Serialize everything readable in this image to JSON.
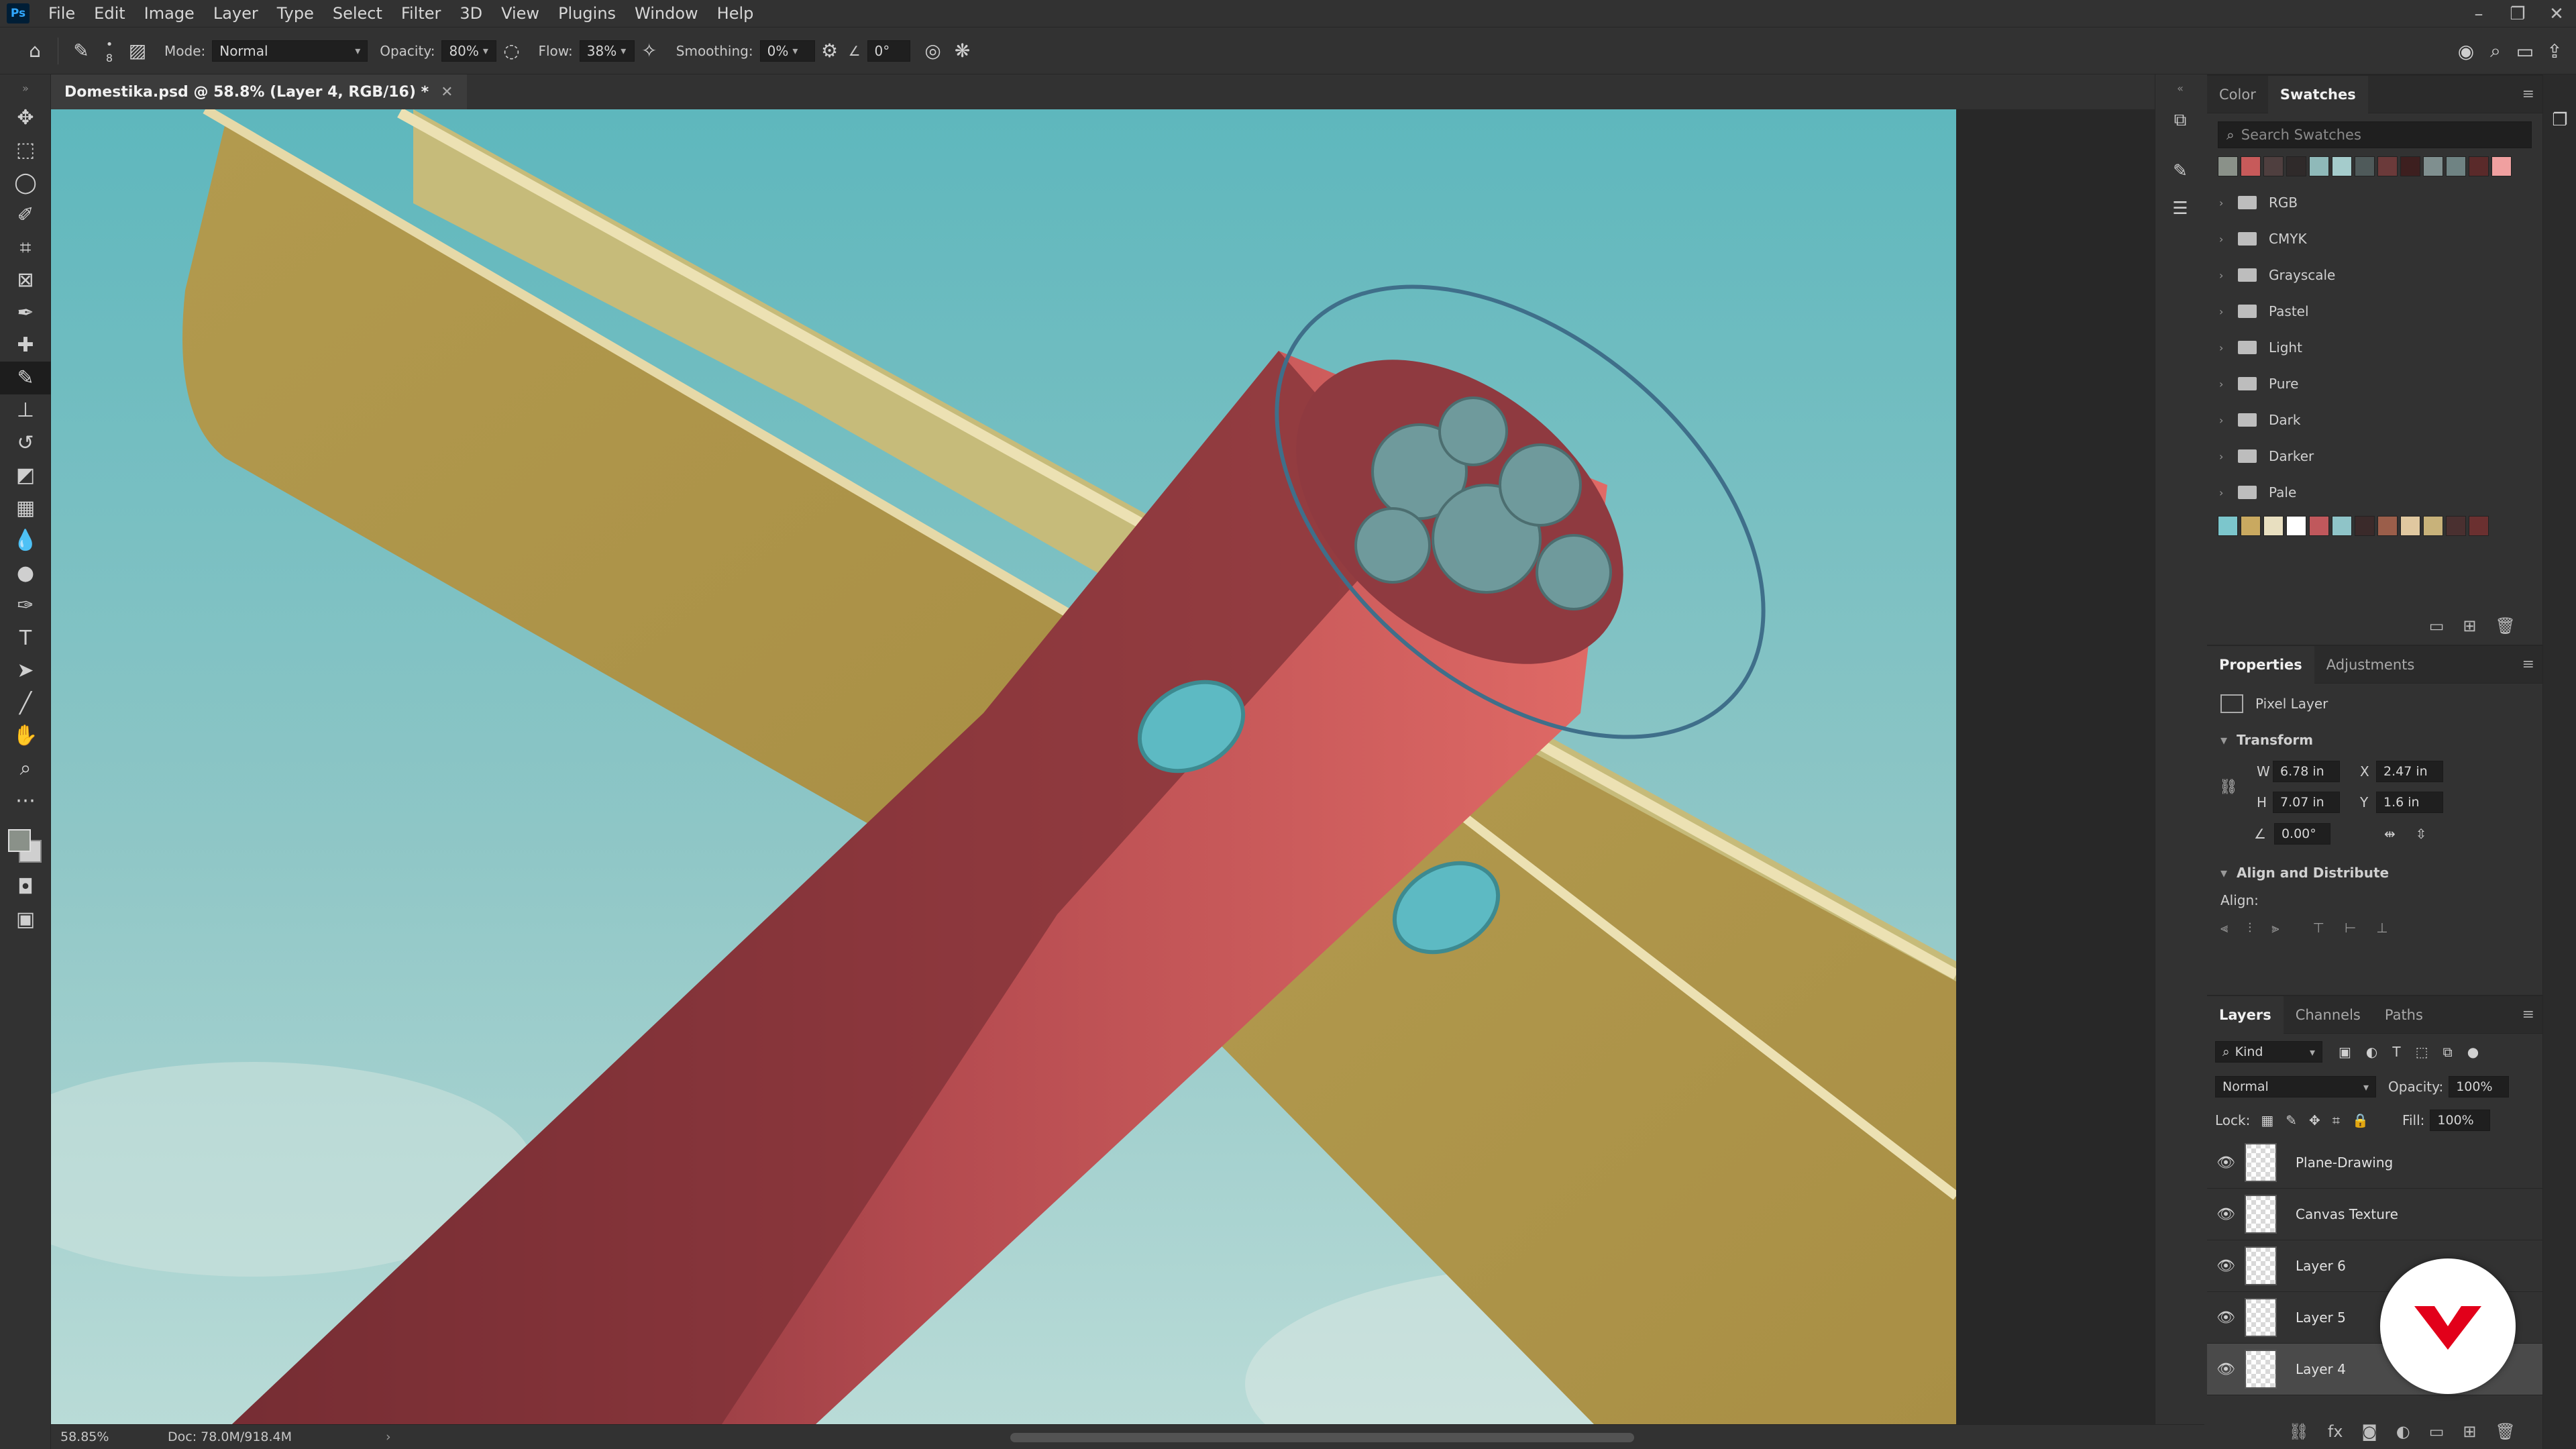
{
  "menubar": {
    "logo": "Ps",
    "items": [
      "File",
      "Edit",
      "Image",
      "Layer",
      "Type",
      "Select",
      "Filter",
      "3D",
      "View",
      "Plugins",
      "Window",
      "Help"
    ]
  },
  "window_controls": {
    "minimize": "–",
    "restore": "❐",
    "close": "✕"
  },
  "options": {
    "brush_size": "8",
    "mode_label": "Mode:",
    "mode_value": "Normal",
    "opacity_label": "Opacity:",
    "opacity_value": "80%",
    "flow_label": "Flow:",
    "flow_value": "38%",
    "smoothing_label": "Smoothing:",
    "smoothing_value": "0%",
    "angle_value": "0°"
  },
  "document": {
    "tab_title": "Domestika.psd @ 58.8% (Layer 4, RGB/16) *",
    "zoom": "58.85%",
    "doc_size": "Doc: 78.0M/918.4M"
  },
  "swatches_panel": {
    "tabs": [
      "Color",
      "Swatches"
    ],
    "active_tab": "Swatches",
    "search_placeholder": "Search Swatches",
    "recent": [
      "#8a9189",
      "#c75a5a",
      "#4f3f3f",
      "#2f2a2a",
      "#8fb9b9",
      "#a5cccc",
      "#4f5a5a",
      "#6b3a3a",
      "#3d1f1f",
      "#7f8f8f",
      "#6f8383",
      "#5a2a2a",
      "#f0a0a0"
    ],
    "folders": [
      "RGB",
      "CMYK",
      "Grayscale",
      "Pastel",
      "Light",
      "Pure",
      "Dark",
      "Darker",
      "Pale"
    ],
    "bottom": [
      "#7cc6cc",
      "#c9a960",
      "#e8dfc0",
      "#ffffff",
      "#c0585c",
      "#8fc4c8",
      "#3a2a2a",
      "#9b5e4a",
      "#e0c8a0",
      "#c8b27a",
      "#4a3030",
      "#6b3030"
    ]
  },
  "properties_panel": {
    "tabs": [
      "Properties",
      "Adjustments"
    ],
    "active_tab": "Properties",
    "layer_type": "Pixel Layer",
    "transform_label": "Transform",
    "w_label": "W",
    "w": "6.78 in",
    "x_label": "X",
    "x": "2.47 in",
    "h_label": "H",
    "h": "7.07 in",
    "y_label": "Y",
    "y": "1.6 in",
    "angle": "0.00°",
    "align_label": "Align and Distribute",
    "align_sub": "Align:"
  },
  "layers_panel": {
    "tabs": [
      "Layers",
      "Channels",
      "Paths"
    ],
    "active_tab": "Layers",
    "filter_value": "Kind",
    "blend_mode": "Normal",
    "opacity_label": "Opacity:",
    "opacity": "100%",
    "lock_label": "Lock:",
    "fill_label": "Fill:",
    "fill": "100%",
    "layers": [
      {
        "name": "Plane-Drawing",
        "selected": false
      },
      {
        "name": "Canvas Texture",
        "selected": false
      },
      {
        "name": "Layer 6",
        "selected": false
      },
      {
        "name": "Layer 5",
        "selected": false
      },
      {
        "name": "Layer 4",
        "selected": true
      }
    ]
  },
  "colors": {
    "sky_top": "#5eb7bd",
    "sky_bottom": "#a9d3d2",
    "wing": "#b09a4f",
    "wing_light": "#c7bd7c",
    "fuselage": "#cf5a5a",
    "fuselage_dark": "#7b2f35",
    "accent": "#5dbac3",
    "domestika_red": "#e2001a"
  }
}
